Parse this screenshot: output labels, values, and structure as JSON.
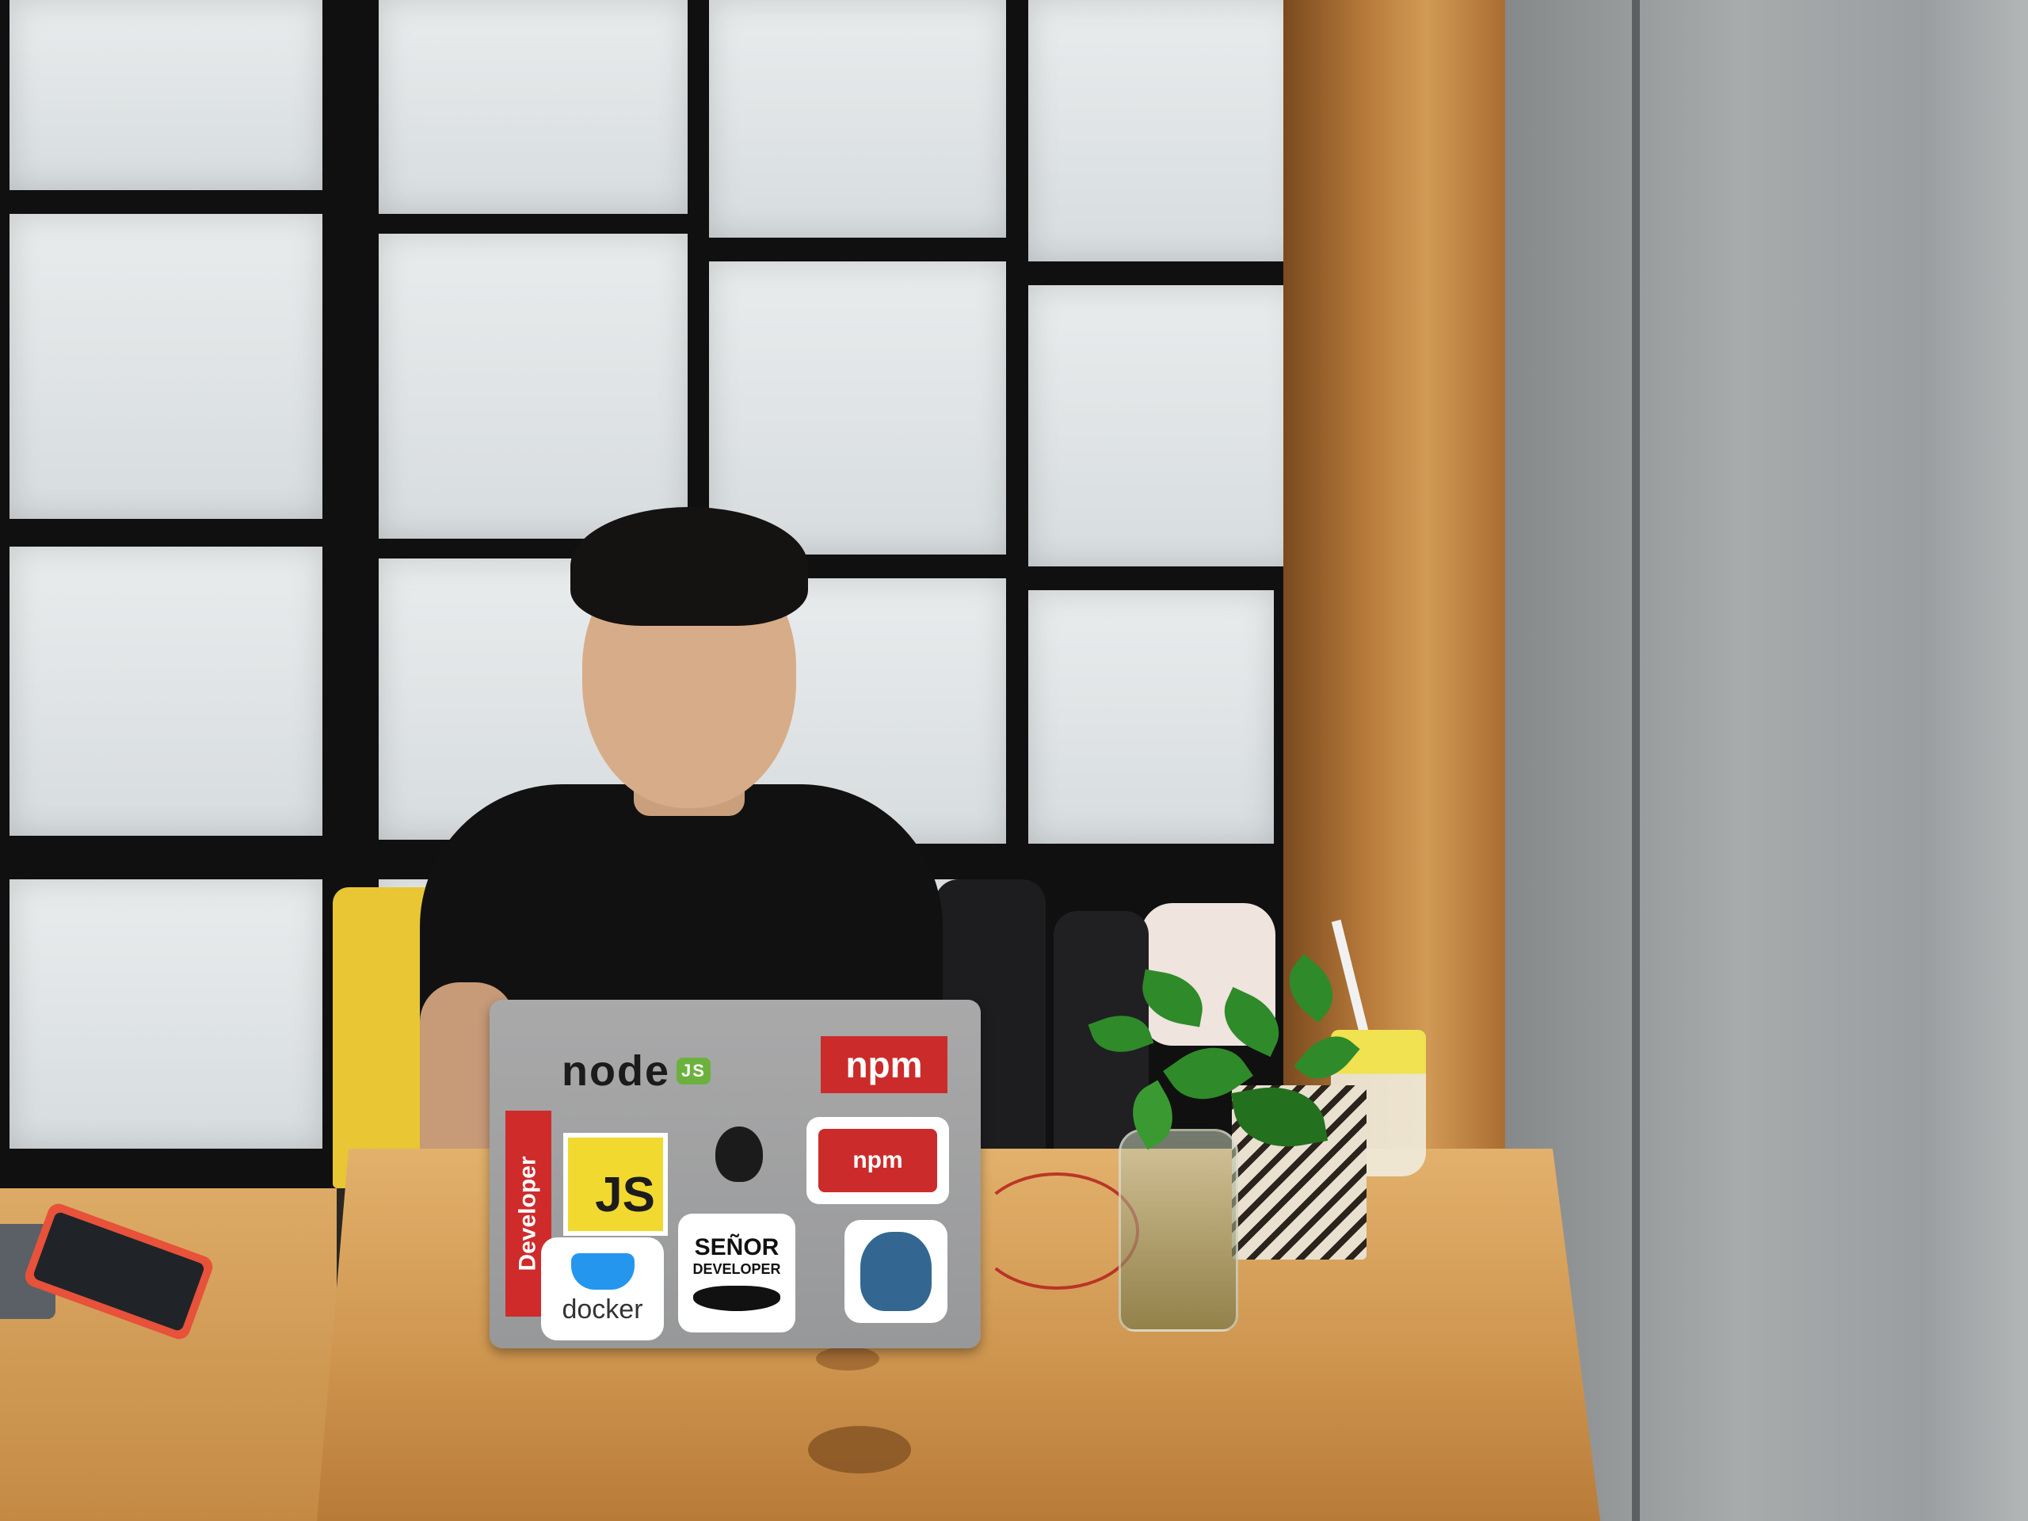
{
  "scene": {
    "laptop_stickers": {
      "node": "node",
      "node_badge": "JS",
      "npm_top": "npm",
      "developer": "Developer",
      "js": "JS",
      "npm_arrows": "npm",
      "senor_line1": "SEÑOR",
      "senor_line2": "DEVELOPER",
      "docker": "docker"
    }
  },
  "colors": {
    "chair": "#e8c634",
    "npm_red": "#cb2c2b",
    "js_yellow": "#f2d930",
    "docker_blue": "#2496ed",
    "postgres_blue": "#336791"
  }
}
